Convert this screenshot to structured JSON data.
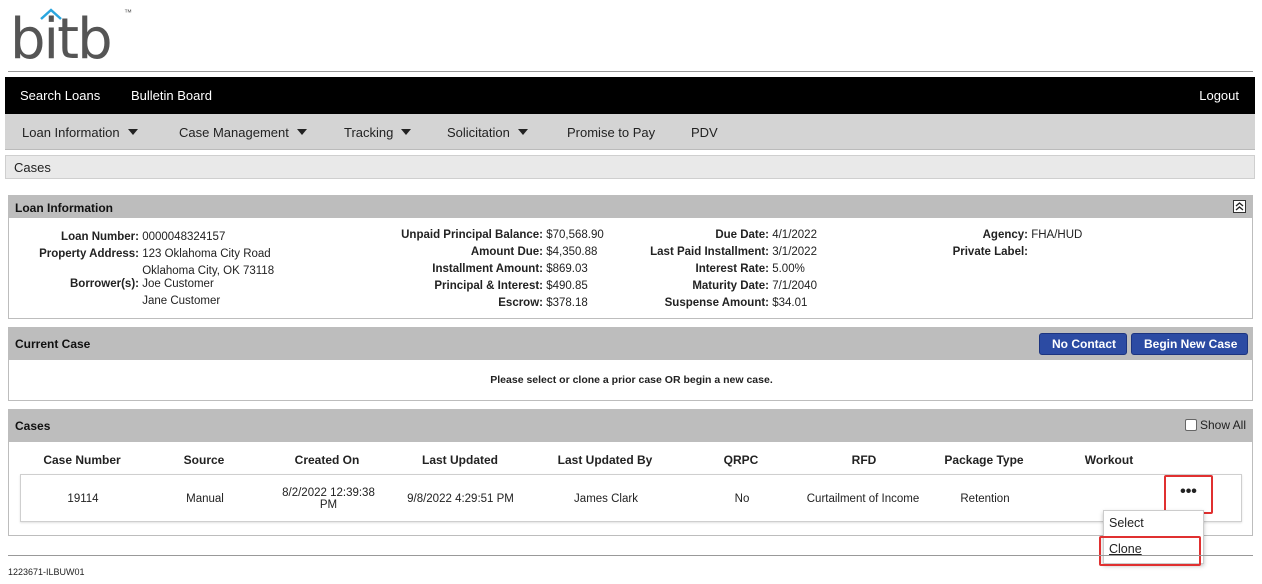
{
  "brand": {
    "logo_text": "bitb",
    "trademark": "™"
  },
  "topnav": {
    "search_loans": "Search Loans",
    "bulletin_board": "Bulletin Board",
    "logout": "Logout"
  },
  "subnav": {
    "items": [
      "Loan Information",
      "Case Management",
      "Tracking",
      "Solicitation",
      "Promise to Pay",
      "PDV"
    ]
  },
  "breadcrumb": "Cases",
  "loan_info": {
    "title": "Loan Information",
    "col1": [
      {
        "label": "Loan Number:",
        "value": "0000048324157"
      },
      {
        "label": "Property Address:",
        "value": "123 Oklahoma City Road",
        "value2": "Oklahoma City, OK 73118"
      },
      {
        "label": "Borrower(s):",
        "value": "Joe Customer",
        "value2": "Jane Customer"
      }
    ],
    "col2": [
      {
        "label": "Unpaid Principal Balance:",
        "value": "$70,568.90"
      },
      {
        "label": "Amount Due:",
        "value": "$4,350.88"
      },
      {
        "label": "Installment Amount:",
        "value": "$869.03"
      },
      {
        "label": "Principal & Interest:",
        "value": "$490.85"
      },
      {
        "label": "Escrow:",
        "value": "$378.18"
      }
    ],
    "col3": [
      {
        "label": "Due Date:",
        "value": "4/1/2022"
      },
      {
        "label": "Last Paid Installment:",
        "value": "3/1/2022"
      },
      {
        "label": "Interest Rate:",
        "value": "5.00%"
      },
      {
        "label": "Maturity Date:",
        "value": "7/1/2040"
      },
      {
        "label": "Suspense Amount:",
        "value": "$34.01"
      }
    ],
    "col4": [
      {
        "label": "Agency:",
        "value": "FHA/HUD"
      },
      {
        "label": "Private Label:",
        "value": ""
      }
    ]
  },
  "current_case": {
    "title": "Current Case",
    "no_contact": "No Contact",
    "begin_new_case": "Begin New Case",
    "message": "Please select or clone a prior case OR begin a new case."
  },
  "cases": {
    "title": "Cases",
    "show_all": "Show All",
    "columns": [
      "Case Number",
      "Source",
      "Created On",
      "Last Updated",
      "Last Updated By",
      "QRPC",
      "RFD",
      "Package Type",
      "Workout"
    ],
    "rows": [
      {
        "case_number": "19114",
        "source": "Manual",
        "created_on_1": "8/2/2022 12:39:38",
        "created_on_2": "PM",
        "last_updated": "9/8/2022 4:29:51 PM",
        "last_updated_by": "James Clark",
        "qrpc": "No",
        "rfd": "Curtailment of Income",
        "package_type": "Retention",
        "workout": ""
      }
    ],
    "action_icon": "•••",
    "menu": {
      "select": "Select",
      "clone": "Clone"
    }
  },
  "footer": {
    "server_id": "1223671-ILBUW01"
  },
  "colors": {
    "nav_bg": "#000000",
    "subnav_bg": "#d4d4d4",
    "panel_head": "#bdbdbd",
    "button": "#2c4ba3",
    "highlight": "#e03030"
  }
}
